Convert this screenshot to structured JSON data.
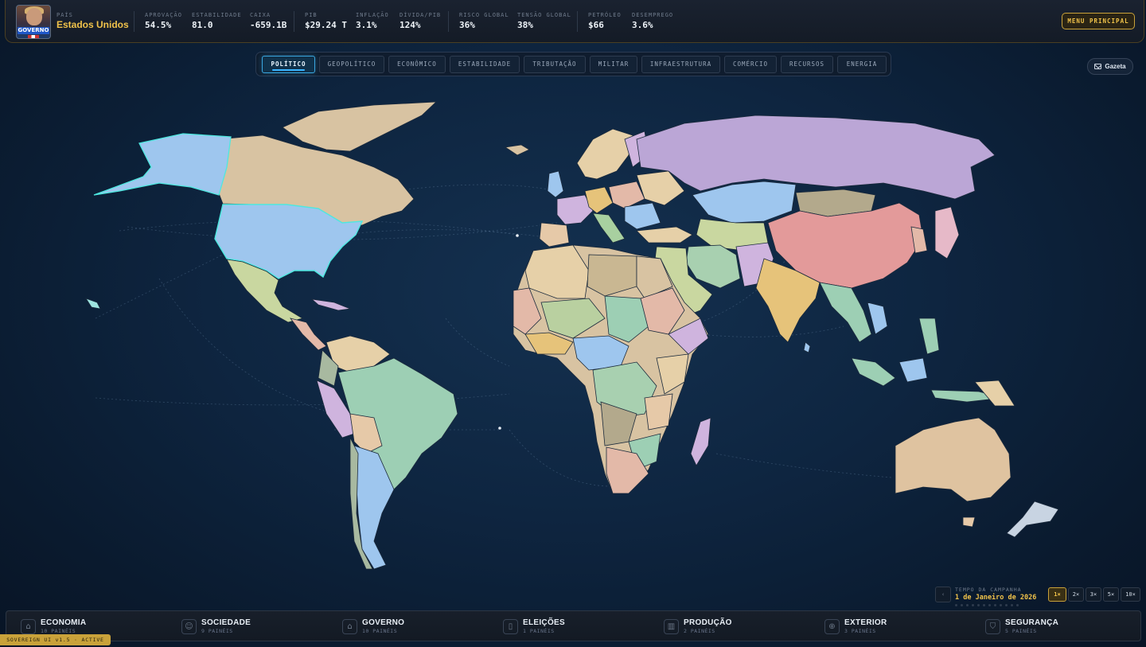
{
  "header": {
    "avatar_tag": "GOVERNO",
    "country_label": "PAÍS",
    "country_name": "Estados Unidos",
    "stats": [
      {
        "label": "APROVAÇÃO",
        "value": "54.5%"
      },
      {
        "label": "ESTABILIDADE",
        "value": "81.0"
      },
      {
        "label": "CAIXA",
        "value": "-659.1B"
      },
      {
        "label": "PIB",
        "value": "$29.24 T"
      },
      {
        "label": "INFLAÇÃO",
        "value": "3.1%"
      },
      {
        "label": "DÍVIDA/PIB",
        "value": "124%"
      },
      {
        "label": "RISCO GLOBAL",
        "value": "36%"
      },
      {
        "label": "TENSÃO GLOBAL",
        "value": "38%"
      },
      {
        "label": "PETRÓLEO",
        "value": "$66"
      },
      {
        "label": "DESEMPREGO",
        "value": "3.6%"
      }
    ],
    "menu_button": "MENU PRINCIPAL"
  },
  "tabs": [
    {
      "label": "POLÍTICO",
      "active": true
    },
    {
      "label": "GEOPOLÍTICO"
    },
    {
      "label": "ECONÔMICO"
    },
    {
      "label": "ESTABILIDADE"
    },
    {
      "label": "TRIBUTAÇÃO"
    },
    {
      "label": "MILITAR"
    },
    {
      "label": "INFRAESTRUTURA"
    },
    {
      "label": "COMÉRCIO"
    },
    {
      "label": "RECURSOS"
    },
    {
      "label": "ENERGIA"
    }
  ],
  "gazeta_button": "Gazeta",
  "map": {
    "selected_country": "Estados Unidos",
    "colors": {
      "ocean": "#0e2540",
      "selected": "#9ec6ee",
      "selected_border": "#4de8e0"
    }
  },
  "time": {
    "label": "TEMPO DA CAMPANHA",
    "date": "1 de Janeiro de 2026",
    "prev_icon": "chevron-left-icon",
    "speeds": [
      "1×",
      "2×",
      "3×",
      "5×",
      "10×"
    ],
    "active_speed": "1×"
  },
  "bottom_nav": [
    {
      "label": "ECONOMIA",
      "sub": "10 PAINÉIS",
      "icon": "bank-icon"
    },
    {
      "label": "SOCIEDADE",
      "sub": "9 PAINÉIS",
      "icon": "people-icon"
    },
    {
      "label": "GOVERNO",
      "sub": "10 PAINÉIS",
      "icon": "capitol-icon"
    },
    {
      "label": "ELEIÇÕES",
      "sub": "1 PAINÉIS",
      "icon": "ballot-icon"
    },
    {
      "label": "PRODUÇÃO",
      "sub": "2 PAINÉIS",
      "icon": "factory-icon"
    },
    {
      "label": "EXTERIOR",
      "sub": "3 PAINÉIS",
      "icon": "globe-icon"
    },
    {
      "label": "SEGURANÇA",
      "sub": "5 PAINÉIS",
      "icon": "shield-icon"
    }
  ],
  "version_badge": "SOVEREIGN UI v1.5 · ACTIVE"
}
